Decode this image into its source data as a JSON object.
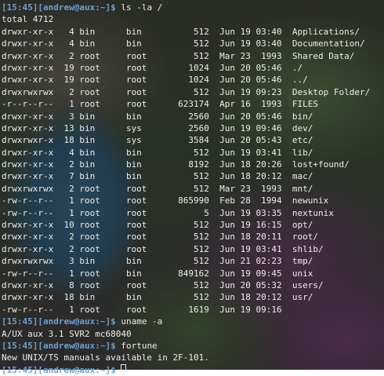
{
  "prompt": "[15:45][andrew@aux:~]$",
  "commands": {
    "ls": " ls -la /",
    "uname": " uname -a",
    "fortune": " fortune"
  },
  "listing": {
    "total": "total 4712",
    "rows": [
      "drwxr-xr-x   4 bin      bin          512  Jun 19 03:40  Applications/",
      "drwxr-xr-x   4 bin      bin          512  Jun 19 03:40  Documentation/",
      "drwxr-xr-x   2 root     root         512  Mar 23  1993  Shared Data/",
      "drwxr-xr-x  19 root     root        1024  Jun 20 05:46  ./",
      "drwxr-xr-x  19 root     root        1024  Jun 20 05:46  ../",
      "drwxrwxrwx   2 root     root         512  Jun 19 09:23  Desktop Folder/",
      "-r--r--r--   1 root     root      623174  Apr 16  1993  FILES",
      "drwxr-xr-x   3 bin      bin         2560  Jun 20 05:46  bin/",
      "drwxr-xr-x  13 bin      sys         2560  Jun 19 09:46  dev/",
      "drwxrwxr-x  18 bin      sys         3584  Jun 20 05:43  etc/",
      "drwxr-xr-x   4 bin      bin          512  Jun 19 03:41  lib/",
      "drwxr-xr-x   2 bin      bin         8192  Jun 18 20:26  lost+found/",
      "drwxr-xr-x   7 bin      bin          512  Jun 18 20:12  mac/",
      "drwxrwxrwx   2 root     root         512  Mar 23  1993  mnt/",
      "-rw-r--r--   1 root     root      865990  Feb 28  1994  newunix",
      "-rw-r--r--   1 root     root           5  Jun 19 03:35  nextunix",
      "drwxr-xr-x  10 root     root         512  Jun 19 16:15  opt/",
      "drwxr-xr-x   2 root     root         512  Jun 18 20:11  root/",
      "drwxr-xr-x   2 root     root         512  Jun 19 03:41  shlib/",
      "drwxrwxrwx   3 bin      bin          512  Jun 21 02:23  tmp/",
      "-rw-r--r--   1 root     bin       849162  Jun 19 09:45  unix",
      "drwxr-xr-x   8 root     root         512  Jun 20 05:32  users/",
      "drwxr-xr-x  18 bin      bin          512  Jun 18 20:12  usr/",
      "-rw-r--r--   1 root     root        1619  Jun 19 09:16"
    ]
  },
  "uname_output": "A/UX aux 3.1 SVR2 mc68040",
  "fortune_output": "New UNIX/TS manuals available in 2F-101."
}
